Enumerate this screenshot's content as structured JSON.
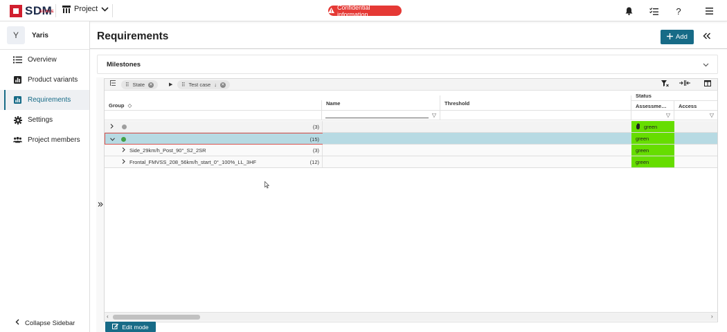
{
  "topbar": {
    "logo_small": "SCALE",
    "logo_text": "SDM",
    "project_label": "Project",
    "confidential_label": "Confidential information",
    "help_label": "?"
  },
  "sidebar": {
    "project_initial": "Y",
    "project_name": "Yaris",
    "items": [
      {
        "label": "Overview",
        "icon": "list-icon"
      },
      {
        "label": "Product variants",
        "icon": "chart-icon"
      },
      {
        "label": "Requirements",
        "icon": "chart-icon",
        "active": true
      },
      {
        "label": "Settings",
        "icon": "gear-icon"
      },
      {
        "label": "Project members",
        "icon": "people-icon"
      }
    ],
    "collapse_label": "Collapse Sidebar"
  },
  "main": {
    "title": "Requirements",
    "add_label": "Add",
    "milestones_label": "Milestones"
  },
  "grid": {
    "group_chips": [
      {
        "label": "State"
      },
      {
        "label": "Test case"
      }
    ],
    "columns": {
      "group": "Group",
      "name": "Name",
      "threshold": "Threshold",
      "status_group": "Status",
      "assessment": "Assessme…",
      "access": "Access"
    },
    "rows": [
      {
        "label": "",
        "count": "(3)",
        "status": "green",
        "state_color": "#9e9e9e",
        "expanded": false,
        "selected": false,
        "level": 0
      },
      {
        "label": "",
        "count": "(15)",
        "status": "green",
        "state_color": "#43a047",
        "expanded": true,
        "selected": true,
        "level": 0
      },
      {
        "label": "Side_29km/h_Post_90°_S2_2SR",
        "count": "(3)",
        "status": "green",
        "level": 1
      },
      {
        "label": "Frontal_FMVSS_208_56km/h_start_0°_100%_LL_3HF",
        "count": "(12)",
        "status": "green",
        "level": 1
      }
    ]
  },
  "footer": {
    "edit_mode_label": "Edit mode"
  },
  "colors": {
    "accent": "#176b87",
    "status_green": "#66dd00",
    "selected_row": "#b7dae3",
    "danger": "#e53935"
  }
}
